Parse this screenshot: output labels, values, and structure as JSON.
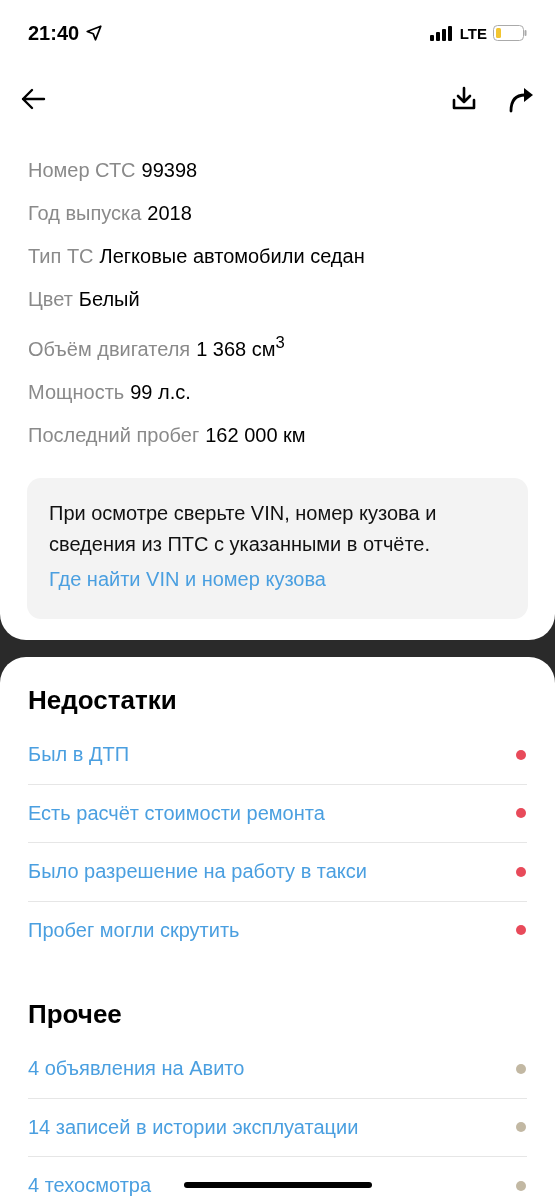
{
  "status_bar": {
    "time": "21:40",
    "network": "LTE"
  },
  "specs": [
    {
      "label": "Номер СТС",
      "value": "99398"
    },
    {
      "label": "Год выпуска",
      "value": "2018"
    },
    {
      "label": "Тип ТС",
      "value": "Легковые автомобили седан"
    },
    {
      "label": "Цвет",
      "value": "Белый"
    },
    {
      "label": "Объём двигателя",
      "value": "1 368 см$^{3}$"
    },
    {
      "label": "Мощность",
      "value": "99 л.с."
    },
    {
      "label": "Последний пробег",
      "value": "162 000 км"
    }
  ],
  "notice": {
    "text": "При осмотре сверьте VIN, номер кузова и сведения из ПТС с указанными в отчёте.",
    "link": "Где найти VIN и номер кузова"
  },
  "sections": [
    {
      "title": "Недостатки",
      "items": [
        {
          "label": "Был в ДТП",
          "color": "#e84a5a"
        },
        {
          "label": "Есть расчёт стоимости ремонта",
          "color": "#e84a5a"
        },
        {
          "label": "Было разрешение на работу в такси",
          "color": "#e84a5a"
        },
        {
          "label": "Пробег могли скрутить",
          "color": "#e84a5a"
        }
      ]
    },
    {
      "title": "Прочее",
      "items": [
        {
          "label": "4 объявления на Авито",
          "color": "#c2b8a3"
        },
        {
          "label": "14 записей в истории эксплуатации",
          "color": "#c2b8a3"
        },
        {
          "label": "4 техосмотра",
          "color": "#c2b8a3"
        }
      ]
    }
  ]
}
